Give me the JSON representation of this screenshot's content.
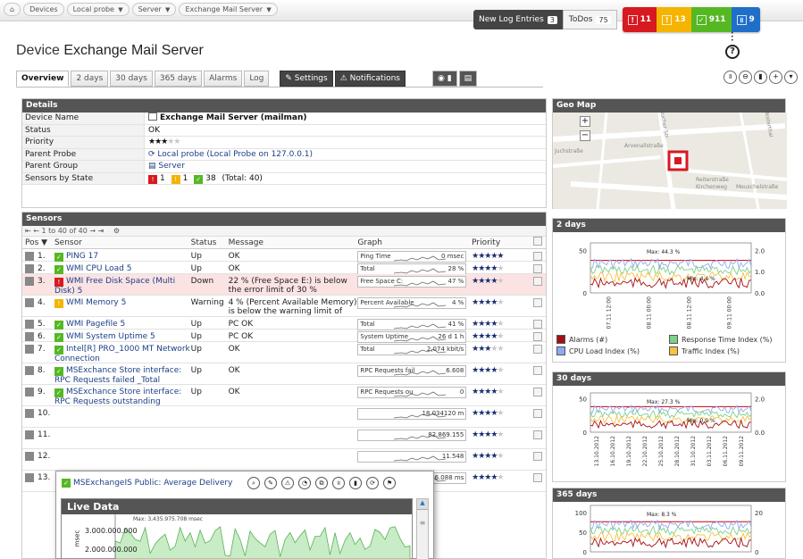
{
  "breadcrumb": [
    "Devices",
    "Local probe",
    "Server",
    "Exchange Mail Server"
  ],
  "header": {
    "new_log_entries_label": "New Log Entries",
    "new_log_entries_count": "3",
    "todos_label": "ToDos",
    "todos_count": "75",
    "status_counts": {
      "red": "11",
      "yellow": "13",
      "green": "911",
      "blue": "9"
    }
  },
  "page": {
    "title_prefix": "Device",
    "title_name": "Exchange Mail Server"
  },
  "tabs": [
    "Overview",
    "2 days",
    "30 days",
    "365 days",
    "Alarms",
    "Log"
  ],
  "tab_settings": "Settings",
  "tab_notifications": "Notifications",
  "details": {
    "heading": "Details",
    "rows": [
      {
        "key": "Device Name",
        "value": "Exchange Mail Server (mailman)"
      },
      {
        "key": "Status",
        "value": "OK"
      },
      {
        "key": "Priority",
        "value": ""
      },
      {
        "key": "Parent Probe",
        "value": "Local probe (Local Probe on 127.0.0.1)"
      },
      {
        "key": "Parent Group",
        "value": "Server"
      },
      {
        "key": "Sensors by State",
        "value": ""
      }
    ],
    "priority_stars": 3,
    "sensors_by_state": {
      "red": "1",
      "yellow": "1",
      "green": "38",
      "total": "(Total: 40)"
    }
  },
  "sensors": {
    "heading": "Sensors",
    "pager": "1 to 40 of 40",
    "columns": [
      "Pos",
      "Sensor",
      "Status",
      "Message",
      "Graph",
      "Priority"
    ],
    "rows": [
      {
        "pos": "1.",
        "name": "PING 17",
        "status": "Up",
        "message": "OK",
        "graph_label": "Ping Time",
        "graph_value": "0 msec",
        "stars": 5,
        "state": "green"
      },
      {
        "pos": "2.",
        "name": "WMI CPU Load 5",
        "status": "Up",
        "message": "OK",
        "graph_label": "Total",
        "graph_value": "28 %",
        "stars": 4,
        "state": "green"
      },
      {
        "pos": "3.",
        "name": "WMI Free Disk Space (Multi Disk) 5",
        "status": "Down",
        "message": "22 % (Free Space E:) is below the error limit of 30 %",
        "graph_label": "Free Space C:",
        "graph_value": "47 %",
        "stars": 4,
        "state": "red"
      },
      {
        "pos": "4.",
        "name": "WMI Memory 5",
        "status": "Warning",
        "message": "4 % (Percent Available Memory) is below the warning limit of",
        "graph_label": "Percent Available",
        "graph_value": "4 %",
        "stars": 4,
        "state": "yellow"
      },
      {
        "pos": "5.",
        "name": "WMI Pagefile 5",
        "status": "Up",
        "message": "PC OK",
        "graph_label": "Total",
        "graph_value": "41 %",
        "stars": 4,
        "state": "green"
      },
      {
        "pos": "6.",
        "name": "WMI System Uptime 5",
        "status": "Up",
        "message": "PC OK",
        "graph_label": "System Uptime",
        "graph_value": "26 d 1 h",
        "stars": 4,
        "state": "green"
      },
      {
        "pos": "7.",
        "name": "Intel[R] PRO_1000 MT Network Connection",
        "status": "Up",
        "message": "OK",
        "graph_label": "Total",
        "graph_value": "2,074 kbit/s",
        "stars": 3,
        "state": "green"
      },
      {
        "pos": "8.",
        "name": "MSExchance Store interface: RPC Requests failed _Total",
        "status": "Up",
        "message": "OK",
        "graph_label": "RPC Requests fail",
        "graph_value": "6.608",
        "stars": 4,
        "state": "green"
      },
      {
        "pos": "9.",
        "name": "MSExchance Store interface: RPC Requests outstanding",
        "status": "Up",
        "message": "OK",
        "graph_label": "RPC Requests ou",
        "graph_value": "0",
        "stars": 4,
        "state": "green"
      },
      {
        "pos": "10.",
        "name": "",
        "status": "",
        "message": "",
        "graph_label": "",
        "graph_value": "18.034120 m",
        "stars": 4,
        "state": "none"
      },
      {
        "pos": "11.",
        "name": "",
        "status": "",
        "message": "",
        "graph_label": "",
        "graph_value": "82.869.155",
        "stars": 4,
        "state": "none"
      },
      {
        "pos": "12.",
        "name": "",
        "status": "",
        "message": "",
        "graph_label": "",
        "graph_value": "11.548",
        "stars": 4,
        "state": "none"
      },
      {
        "pos": "13.",
        "name": "",
        "status": "",
        "message": "",
        "graph_label": "",
        "graph_value": "536.088 ms",
        "stars": 4,
        "state": "none"
      }
    ]
  },
  "geo": {
    "heading": "Geo Map",
    "streets": [
      "Arvenallstraße",
      "Bucher Str.",
      "Reiterstraße",
      "Kirchenweg",
      "Meuschelstraße",
      "Juchstraße",
      "Westerthal"
    ]
  },
  "popup": {
    "title": "MSExchangeIS Public: Average Delivery",
    "live_heading": "Live Data",
    "max_label": "Max: 3,435.975.708 msec",
    "y_tick_top": "3.000.000.000",
    "y_tick_mid": "2.000.000.000",
    "y_axis_unit": "msec"
  },
  "chart_data": [
    {
      "type": "line",
      "title": "2 days",
      "x": [
        "07.11 12:00",
        "08.11 00:00",
        "08.11 12:00",
        "09.11 00:00"
      ],
      "y_left_ticks": [
        "0",
        "50"
      ],
      "y_right_ticks": [
        "0.0",
        "1.0",
        "2.0"
      ],
      "annotations": [
        "Max: 44.3 %",
        "Min: 4.4 %"
      ],
      "series": [
        {
          "name": "Alarms (#)",
          "color": "#a50f15"
        },
        {
          "name": "Response Time Index (%)",
          "color": "#7fd08a"
        },
        {
          "name": "CPU Load Index (%)",
          "color": "#8fa8f5"
        },
        {
          "name": "Traffic Index (%)",
          "color": "#f5c242"
        }
      ]
    },
    {
      "type": "line",
      "title": "30 days",
      "x": [
        "13.10.2012",
        "16.10.2012",
        "19.10.2012",
        "22.10.2012",
        "25.10.2012",
        "28.10.2012",
        "31.10.2012",
        "03.11.2012",
        "06.11.2012",
        "09.11.2012"
      ],
      "y_left_ticks": [
        "0",
        "50"
      ],
      "y_right_ticks": [
        "0.0",
        "2.0"
      ],
      "annotations": [
        "Max: 27.3 %",
        "Min: 0.9 %"
      ]
    },
    {
      "type": "line",
      "title": "365 days",
      "y_left_ticks": [
        "0",
        "50",
        "100"
      ],
      "y_right_ticks": [
        "0",
        "20"
      ],
      "annotations": [
        "Max: 8.3 %"
      ]
    }
  ]
}
